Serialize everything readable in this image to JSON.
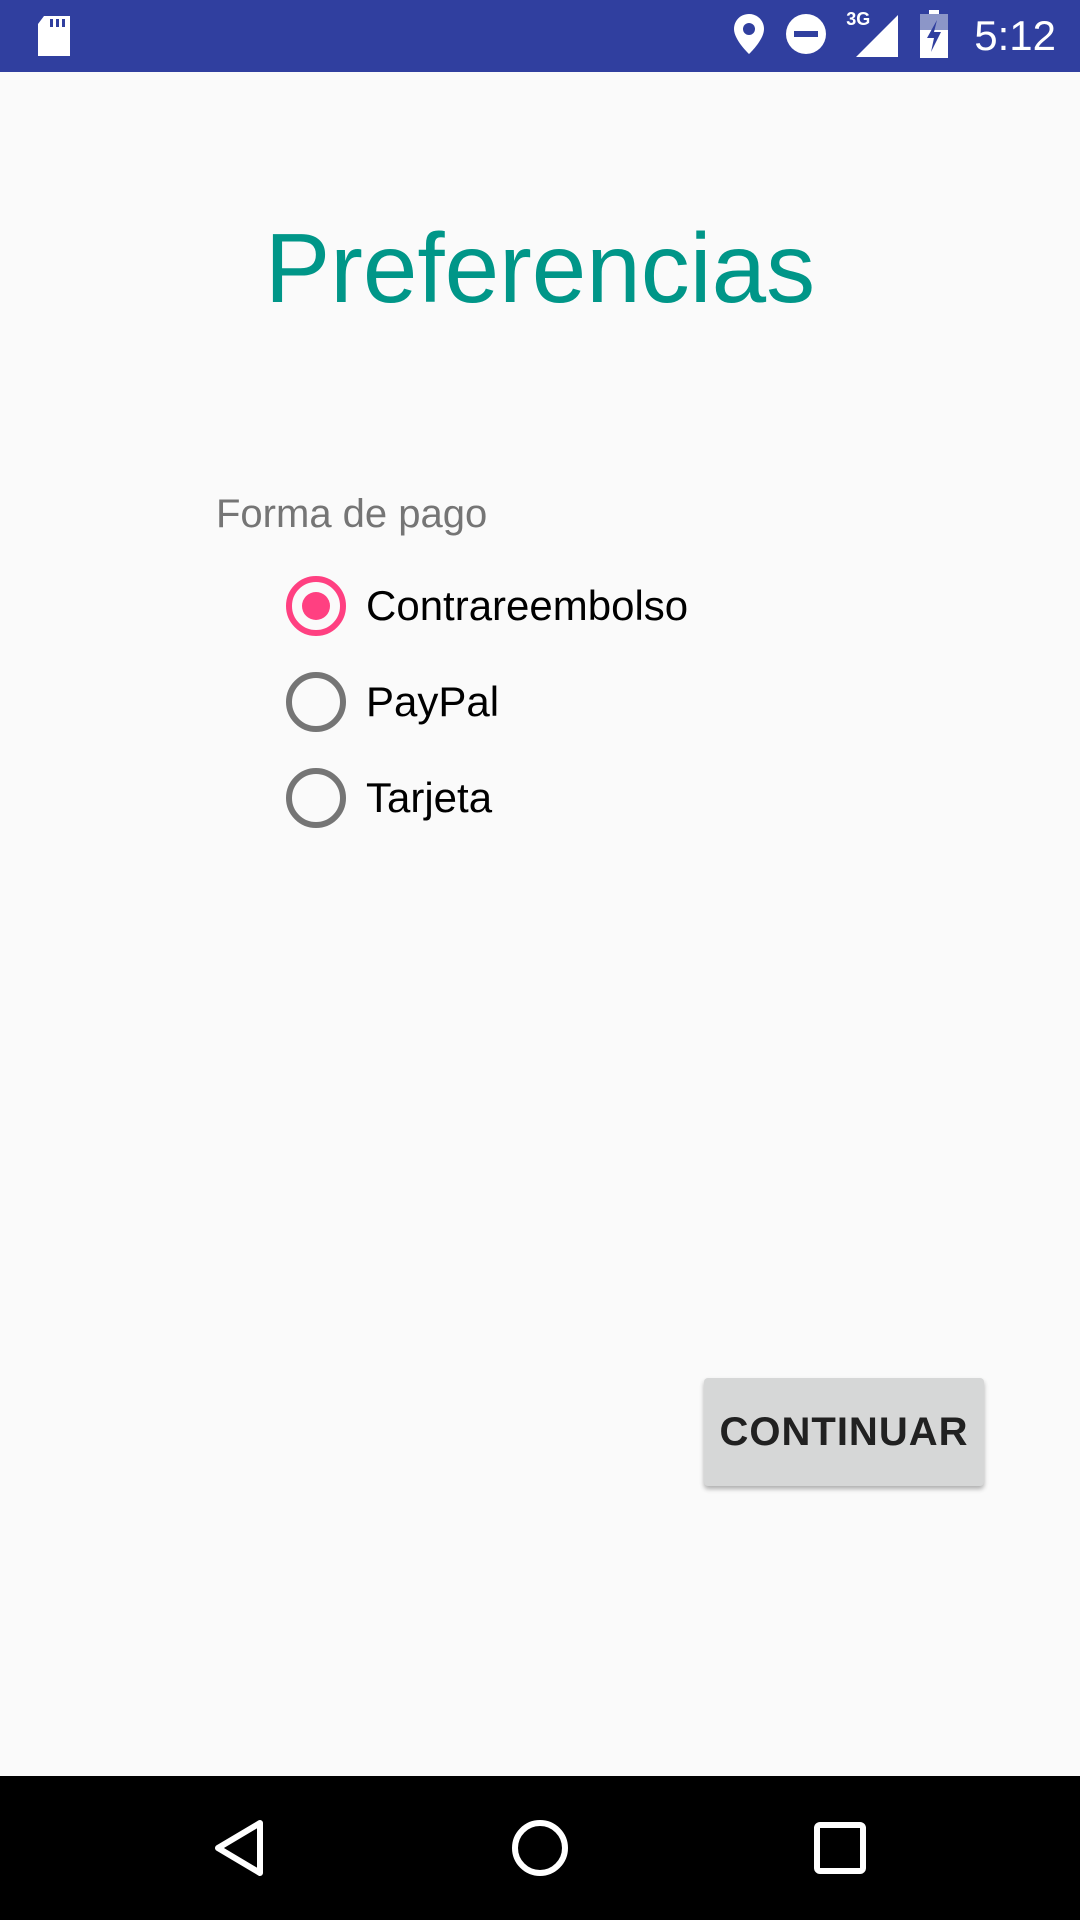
{
  "status_bar": {
    "time": "5:12",
    "network_type": "3G",
    "icons": [
      "sd-card-icon",
      "location-icon",
      "do-not-disturb-icon",
      "signal-icon",
      "battery-charging-icon"
    ],
    "background_color": "#303f9f"
  },
  "screen": {
    "title": "Preferencias",
    "title_color": "#009688"
  },
  "payment": {
    "label": "Forma de pago",
    "options": [
      {
        "label": "Contrareembolso",
        "checked": true
      },
      {
        "label": "PayPal",
        "checked": false
      },
      {
        "label": "Tarjeta",
        "checked": false
      }
    ],
    "accent_color": "#ff4081"
  },
  "actions": {
    "continue_label": "CONTINUAR"
  },
  "nav_bar": {
    "icons": [
      "back-icon",
      "home-icon",
      "recents-icon"
    ]
  }
}
